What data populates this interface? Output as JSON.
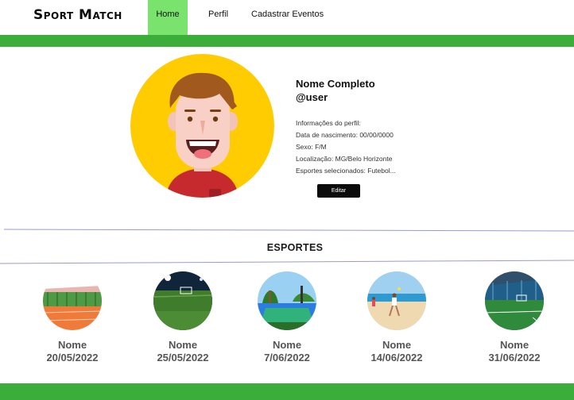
{
  "nav": {
    "brand": "Sport Match",
    "items": [
      "Home",
      "Perfil",
      "Cadastrar Eventos"
    ],
    "active": "Home"
  },
  "profile": {
    "name": "Nome Completo",
    "user": "@user",
    "info": [
      "Informações do perfil:",
      "Data de nascimento: 00/00/0000",
      "Sexo: F/M",
      "Localização:  MG/Belo Horizonte",
      "Esportes selecionados: Futebol..."
    ],
    "edit_label": "Editar"
  },
  "sports": {
    "title": "ESPORTES",
    "items": [
      {
        "name": "Nome",
        "date": "20/05/2022",
        "image": "tennis-court-icon"
      },
      {
        "name": "Nome",
        "date": "25/05/2022",
        "image": "soccer-field-night-icon"
      },
      {
        "name": "Nome",
        "date": "7/06/2022",
        "image": "basketball-court-icon"
      },
      {
        "name": "Nome",
        "date": "14/06/2022",
        "image": "beach-volleyball-icon"
      },
      {
        "name": "Nome",
        "date": "31/06/2022",
        "image": "indoor-soccer-icon"
      }
    ]
  },
  "colors": {
    "accent_green": "#3bad3a",
    "active_tab": "#79e36e",
    "avatar_bg": "#fecc00",
    "button": "#0b0b0b"
  }
}
